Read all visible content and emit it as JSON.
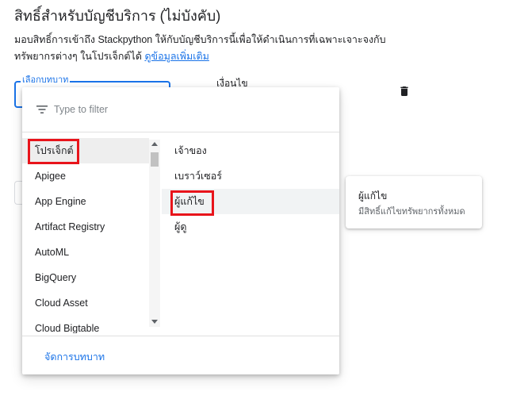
{
  "header": {
    "title": "สิทธิ์สำหรับบัญชีบริการ (ไม่บังคับ)",
    "description_line1": "มอบสิทธิ์การเข้าถึง Stackpython ให้กับบัญชีบริการนี้เพื่อให้ดำเนินการที่เฉพาะเจาะจงกับ",
    "description_line2": "ทรัพยากรต่างๆ ในโปรเจ็กต์ได้",
    "learn_more_link": "ดูข้อมูลเพิ่มเติม"
  },
  "role_field": {
    "label": "เลือกบทบาท",
    "condition_label": "เงื่อนไข"
  },
  "icons": {
    "delete": "trash-icon",
    "filter": "filter-list-icon",
    "scroll_up": "arrow-up-icon",
    "scroll_down": "arrow-down-icon"
  },
  "dropdown": {
    "filter_placeholder": "Type to filter",
    "filter_value": "",
    "categories": [
      "โปรเจ็กต์",
      "Apigee",
      "App Engine",
      "Artifact Registry",
      "AutoML",
      "BigQuery",
      "Cloud Asset",
      "Cloud Bigtable"
    ],
    "selected_category": "โปรเจ็กต์",
    "roles": [
      "เจ้าของ",
      "เบราว์เซอร์",
      "ผู้แก้ไข",
      "ผู้ดู"
    ],
    "hovered_role": "ผู้แก้ไข",
    "manage_roles": "จัดการบทบาท"
  },
  "tooltip": {
    "title": "ผู้แก้ไข",
    "description": "มีสิทธิ์แก้ไขทรัพยากรทั้งหมด"
  },
  "annotations": {
    "highlight_color": "#e8141b"
  },
  "colors": {
    "accent": "#1a73e8",
    "text": "#202124",
    "muted": "#5f6368"
  }
}
